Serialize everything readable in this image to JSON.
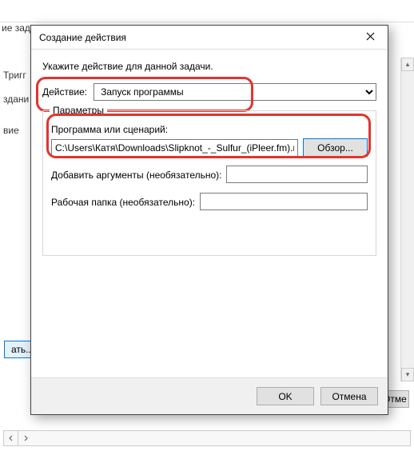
{
  "bg": {
    "title_fragment": "ие зад",
    "tab_trigger": "Тригг",
    "btn_create": "здани",
    "label_vie": "вие",
    "btn_at": "ать...",
    "btn_otme": "Отме"
  },
  "dialog": {
    "title": "Создание действия",
    "instruction": "Укажите действие для данной задачи.",
    "action_label": "Действие:",
    "action_selected": "Запуск программы",
    "params_legend": "Параметры",
    "program_label": "Программа или сценарий:",
    "program_value": "C:\\Users\\Катя\\Downloads\\Slipknot_-_Sulfur_(iPleer.fm).m",
    "browse_label": "Обзор...",
    "args_label": "Добавить аргументы (необязательно):",
    "args_value": "",
    "workdir_label": "Рабочая папка (необязательно):",
    "workdir_value": "",
    "ok_label": "OK",
    "cancel_label": "Отмена"
  }
}
